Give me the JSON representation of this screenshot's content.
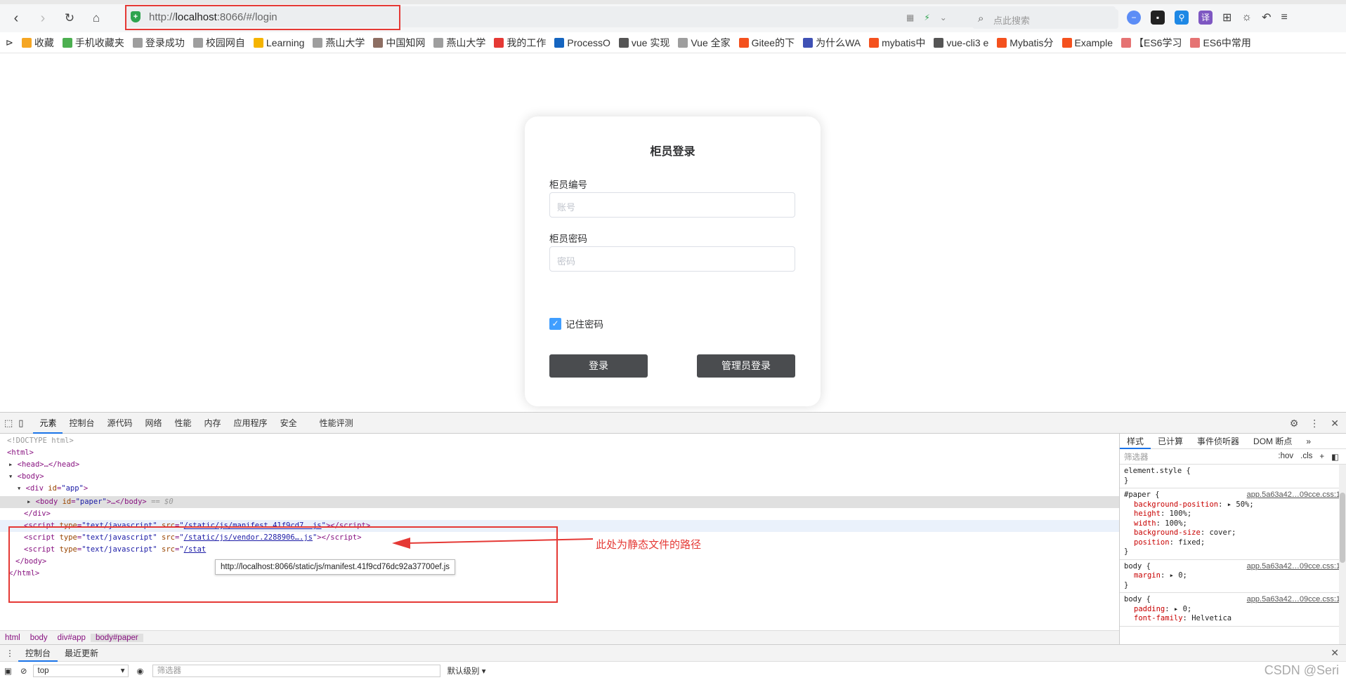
{
  "browser": {
    "url_prefix": "http://",
    "url_host": "localhost",
    "url_rest": ":8066/#/login",
    "search_placeholder": "点此搜索",
    "bookmarks": [
      {
        "label": "收藏",
        "icon": "star-icon",
        "color": "#f5a623"
      },
      {
        "label": "手机收藏夹",
        "icon": "phone-icon",
        "color": "#4caf50"
      },
      {
        "label": "登录成功",
        "icon": "page-icon",
        "color": "#9e9e9e"
      },
      {
        "label": "校园网自",
        "icon": "page-icon",
        "color": "#9e9e9e"
      },
      {
        "label": "Learning",
        "icon": "folder-icon",
        "color": "#f5b400"
      },
      {
        "label": "燕山大学",
        "icon": "page-icon",
        "color": "#9e9e9e"
      },
      {
        "label": "中国知网",
        "icon": "cnki-icon",
        "color": "#8d6e63"
      },
      {
        "label": "燕山大学",
        "icon": "page-icon",
        "color": "#9e9e9e"
      },
      {
        "label": "我的工作",
        "icon": "g-icon",
        "color": "#e53935"
      },
      {
        "label": "ProcessO",
        "icon": "on-icon",
        "color": "#1565c0"
      },
      {
        "label": "vue 实现",
        "icon": "vue-icon",
        "color": "#555555"
      },
      {
        "label": "Vue 全家",
        "icon": "page-icon",
        "color": "#9e9e9e"
      },
      {
        "label": "Gitee的下",
        "icon": "csdn-icon",
        "color": "#f4511e"
      },
      {
        "label": "为什么WA",
        "icon": "wordpress-icon",
        "color": "#3f51b5"
      },
      {
        "label": "mybatis中",
        "icon": "csdn-icon",
        "color": "#f4511e"
      },
      {
        "label": "vue-cli3 e",
        "icon": "vue-icon",
        "color": "#555555"
      },
      {
        "label": "Mybatis分",
        "icon": "csdn-icon",
        "color": "#f4511e"
      },
      {
        "label": "Example",
        "icon": "csdn-icon",
        "color": "#f4511e"
      },
      {
        "label": "【ES6学习",
        "icon": "jianshu-icon",
        "color": "#e57373"
      },
      {
        "label": "ES6中常用",
        "icon": "jianshu-icon",
        "color": "#e57373"
      }
    ]
  },
  "login": {
    "title": "柜员登录",
    "account_label": "柜员编号",
    "account_placeholder": "账号",
    "password_label": "柜员密码",
    "password_placeholder": "密码",
    "remember_label": "记住密码",
    "remember_checked": true,
    "login_button": "登录",
    "admin_button": "管理员登录"
  },
  "devtools": {
    "tabs": [
      "元素",
      "控制台",
      "源代码",
      "网络",
      "性能",
      "内存",
      "应用程序",
      "安全",
      "性能评测"
    ],
    "active_tab": "元素",
    "tree": {
      "doctype": "<!DOCTYPE html>",
      "html_open": "<html>",
      "head": "<head>…</head>",
      "body_open": "<body>",
      "div_app_tag": "div",
      "div_app_id": "app",
      "body_paper_id": "paper",
      "selected_marker": "== $0",
      "div_close": "</div>",
      "script1_src": "/static/js/manifest.41f9cd7….js",
      "script2_src": "/static/js/vendor.2288906….js",
      "script3_src": "/stat",
      "body_close": "</body>",
      "html_close": "</html>",
      "script_type": "text/javascript"
    },
    "annotation_text": "此处为静态文件的路径",
    "tooltip": "http://localhost:8066/static/js/manifest.41f9cd76dc92a37700ef.js",
    "breadcrumb": [
      "html",
      "body",
      "div#app",
      "body#paper"
    ],
    "styles": {
      "tabs": [
        "样式",
        "已计算",
        "事件侦听器",
        "DOM 断点"
      ],
      "filter_placeholder": "筛选器",
      "hov": ":hov",
      "cls": ".cls",
      "element_style": "element.style {",
      "source": "app.5a63a42…09cce.css:1",
      "rules": [
        {
          "selector": "#paper {",
          "props": [
            [
              "background-position",
              "▸ 50%;"
            ],
            [
              "height",
              "100%;"
            ],
            [
              "width",
              "100%;"
            ],
            [
              "background-size",
              "cover;"
            ],
            [
              "position",
              "fixed;"
            ]
          ]
        },
        {
          "selector": "body {",
          "props": [
            [
              "margin",
              "▸ 0;"
            ]
          ]
        },
        {
          "selector": "body {",
          "props": [
            [
              "padding",
              "▸ 0;"
            ],
            [
              "font-family",
              "Helvetica"
            ]
          ]
        }
      ]
    },
    "drawer_tabs": [
      "控制台",
      "最近更新"
    ],
    "console_context": "top",
    "console_filter_placeholder": "筛选器",
    "console_level": "默认级别 ▾",
    "watermark": "CSDN @Seri"
  }
}
